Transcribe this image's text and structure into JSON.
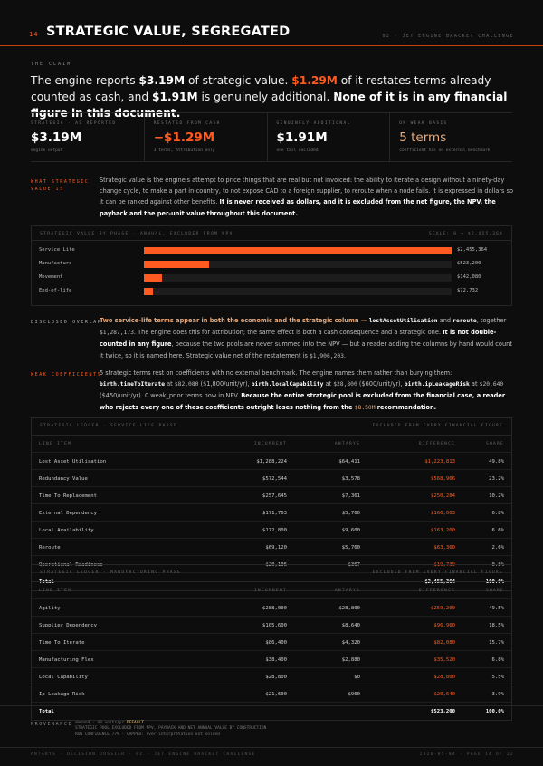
{
  "header": {
    "number": "14",
    "title": "STRATEGIC VALUE, SEGREGATED",
    "right": "02 · JET ENGINE BRACKET CHALLENGE"
  },
  "claim": {
    "label": "THE CLAIM",
    "p1": "The engine reports ",
    "v1": "$3.19M",
    "p2": " of strategic value. ",
    "v2": "$1.29M",
    "p3": " of it restates terms already counted as cash, and ",
    "v3": "$1.91M",
    "p4": " is genuinely additional. ",
    "p5": "None of it is in any financial figure in this document."
  },
  "kpis": [
    {
      "label": "STRATEGIC · AS REPORTED",
      "value": "$3.19M",
      "sub": "engine output",
      "color": "#ffffff"
    },
    {
      "label": "RESTATED FROM CASH",
      "value": "−$1.29M",
      "sub": "3 terms, attribution only",
      "color": "#ff5a1f"
    },
    {
      "label": "GENUINELY ADDITIONAL",
      "value": "$1.91M",
      "sub": "one tail excluded",
      "color": "#ffffff"
    },
    {
      "label": "ON WEAK BASIS",
      "value": "5 terms",
      "sub": "coefficient has no external benchmark",
      "color": "#e9a97a"
    }
  ],
  "what": {
    "label_l1": "WHAT STRATEGIC",
    "label_l2": "VALUE IS",
    "t1": "Strategic value is the engine's attempt to price things that are real but not invoiced: the ability to iterate a design without a ninety-day change cycle, to make a part in-country, to not expose CAD to a foreign supplier, to reroute when a node fails. It is expressed in dollars so it can be ranked against other benefits. ",
    "t2": "It is never received as dollars, and it is excluded from the net figure, the NPV, the payback and the per-unit value throughout this document."
  },
  "bar_chart": {
    "title": "STRATEGIC VALUE BY PHASE · ANNUAL, EXCLUDED FROM NPV",
    "scale": "SCALE: 0 → $2,455,364",
    "max": 2455364,
    "rows": [
      {
        "label": "Service Life",
        "value": 2455364,
        "display": "$2,455,364"
      },
      {
        "label": "Manufacture",
        "value": 523200,
        "display": "$523,200"
      },
      {
        "label": "Movement",
        "value": 142080,
        "display": "$142,080"
      },
      {
        "label": "End-of-life",
        "value": 72732,
        "display": "$72,732"
      }
    ]
  },
  "disclosed": {
    "label": "DISCLOSED OVERLAP",
    "t1": "Two service-life terms appear in both the economic and the strategic column — ",
    "t2": "lostAssetUtilisation",
    "t3": " and ",
    "t4": "reroute",
    "t5": ", together ",
    "t6": "$1,287,173",
    "t7": ". The engine does this for attribution; the same effect is both a cash consequence and a strategic one. ",
    "t8": "It is not double-counted in any figure",
    "t9": ", because the two pools are never summed into the NPV — but a reader adding the columns by hand would count it twice, so it is named here. Strategic value net of the restatement is ",
    "t10": "$1,906,203",
    "t11": "."
  },
  "weak": {
    "label": "WEAK COEFFICIENTS",
    "t1": "5 strategic terms rest on coefficients with no external benchmark. The engine names them rather than burying them: ",
    "t2": "birth.timeToIterate",
    "t3": " at ",
    "t4": "$82,080",
    "t5": " ($1,800/unit/yr), ",
    "t6": "birth.localCapability",
    "t7": " at ",
    "t8": "$28,800",
    "t9": " ($600/unit/yr), ",
    "t10": "birth.ipLeakageRisk",
    "t11": " at ",
    "t12": "$20,640",
    "t13": " ($450/unit/yr). 0 weak_prior terms now in NPV. ",
    "t14": "Because the entire strategic pool is excluded from the financial case, a reader who rejects every one of these coefficients outright loses nothing from the ",
    "t15": "$8.50M",
    "t16": " recommendation."
  },
  "table1": {
    "title": "STRATEGIC LEDGER · SERVICE-LIFE PHASE",
    "note": "EXCLUDED FROM EVERY FINANCIAL FIGURE",
    "columns": [
      "LINE ITEM",
      "INCUMBENT",
      "ANTARYS",
      "DIFFERENCE",
      "SHARE"
    ],
    "rows": [
      {
        "item": "Lost Asset Utilisation",
        "inc": "$1,288,224",
        "ant": "$64,411",
        "diff": "$1,223,813",
        "share": "49.8%"
      },
      {
        "item": "Redundancy Value",
        "inc": "$572,544",
        "ant": "$3,578",
        "diff": "$568,966",
        "share": "23.2%"
      },
      {
        "item": "Time To Replacement",
        "inc": "$257,645",
        "ant": "$7,361",
        "diff": "$250,284",
        "share": "10.2%"
      },
      {
        "item": "External Dependency",
        "inc": "$171,763",
        "ant": "$5,760",
        "diff": "$166,003",
        "share": "6.8%"
      },
      {
        "item": "Local Availability",
        "inc": "$172,800",
        "ant": "$9,600",
        "diff": "$163,200",
        "share": "6.6%"
      },
      {
        "item": "Reroute",
        "inc": "$69,120",
        "ant": "$5,760",
        "diff": "$63,360",
        "share": "2.6%"
      },
      {
        "item": "Operational Readiness",
        "inc": "$20,106",
        "ant": "$367",
        "diff": "$19,739",
        "share": "0.8%"
      }
    ],
    "total": {
      "item": "Total",
      "diff": "$2,455,364",
      "share": "100.0%"
    }
  },
  "table2": {
    "title": "STRATEGIC LEDGER · MANUFACTURING PHASE",
    "note": "EXCLUDED FROM EVERY FINANCIAL FIGURE",
    "columns": [
      "LINE ITEM",
      "INCUMBENT",
      "ANTARYS",
      "DIFFERENCE",
      "SHARE"
    ],
    "rows": [
      {
        "item": "Agility",
        "inc": "$288,000",
        "ant": "$28,800",
        "diff": "$259,200",
        "share": "49.5%"
      },
      {
        "item": "Supplier Dependency",
        "inc": "$105,600",
        "ant": "$8,640",
        "diff": "$96,960",
        "share": "18.5%"
      },
      {
        "item": "Time To Iterate",
        "inc": "$86,400",
        "ant": "$4,320",
        "diff": "$82,080",
        "share": "15.7%"
      },
      {
        "item": "Manufacturing Flex",
        "inc": "$38,400",
        "ant": "$2,880",
        "diff": "$35,520",
        "share": "6.8%"
      },
      {
        "item": "Local Capability",
        "inc": "$28,800",
        "ant": "$0",
        "diff": "$28,800",
        "share": "5.5%"
      },
      {
        "item": "Ip Leakage Risk",
        "inc": "$21,600",
        "ant": "$960",
        "diff": "$20,640",
        "share": "3.9%"
      }
    ],
    "total": {
      "item": "Total",
      "diff": "$523,200",
      "share": "100.0%"
    }
  },
  "provenance": {
    "label": "PROVENANCE",
    "l1a": "demand · 48 units/yr ",
    "l1b": "DEFAULT",
    "l2": "STRATEGIC POOL EXCLUDED FROM NPV, PAYBACK AND NET ANNUAL VALUE BY CONSTRUCTION",
    "l3": "RUN CONFIDENCE 77% · CAPPED: over-interpretation not solved"
  },
  "footer": {
    "left": "ANTARYS · DECISION DOSSIER · 02 · JET ENGINE BRACKET CHALLENGE",
    "right": "2026-05-04 · PAGE 14 OF 22"
  },
  "colors": {
    "accent": "#ff5a1f",
    "tan": "#e9a97a",
    "background": "#0d0d0d"
  }
}
